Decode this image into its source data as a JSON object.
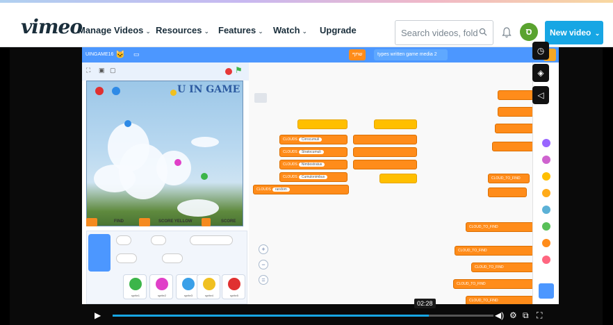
{
  "header": {
    "logo": "vimeo",
    "nav": [
      {
        "label": "Manage Videos",
        "has_dropdown": true
      },
      {
        "label": "Resources",
        "has_dropdown": true
      },
      {
        "label": "Features",
        "has_dropdown": true
      },
      {
        "label": "Watch",
        "has_dropdown": true
      },
      {
        "label": "Upgrade",
        "has_dropdown": false
      }
    ],
    "search_placeholder": "Search videos, folder",
    "avatar_letter": "ס",
    "new_video_label": "New video",
    "brand_color": "#17a6e4",
    "avatar_color": "#5aa32f"
  },
  "scratch": {
    "project_title": "UINGAME16",
    "stage_title": "U IN GAME",
    "share_label": "שתף",
    "project_page_label": "types written game media 2",
    "score_boxes": [
      "FIND",
      "SCORE YELLOW",
      "SCORE"
    ],
    "code_blocks": [
      "CLOUDS",
      "CLOUDS",
      "CLOUDS",
      "CLOUDS",
      "CLOUDS"
    ],
    "block_slots": [
      "Cirrocumuli",
      "Stratocumuli",
      "Nimbostratus",
      "Cumulonimbus",
      "random"
    ],
    "right_blocks": [
      "CLOUD_TO_FIND",
      "CLOUD_TO_FIND",
      "CLOUD_TO_FIND",
      "CLOUD_TO_FIND",
      "CLOUD_TO_FIND",
      "CLOUD_TO_FIND"
    ],
    "sprites": [
      {
        "name": "sprite1",
        "color": "#3cb54a"
      },
      {
        "name": "sprite2",
        "color": "#e040c8"
      },
      {
        "name": "sprite3",
        "color": "#3aa0e8"
      },
      {
        "name": "sprite4",
        "color": "#f0c020"
      },
      {
        "name": "sprite5",
        "color": "#e03030"
      }
    ],
    "categories": [
      "#4c97ff",
      "#9966ff",
      "#cf63cf",
      "#ffbf00",
      "#ffab19",
      "#5cb1d6",
      "#59c059",
      "#ff8c1a",
      "#ff6680"
    ]
  },
  "player": {
    "current_time": "02:28",
    "progress": 0.83
  }
}
